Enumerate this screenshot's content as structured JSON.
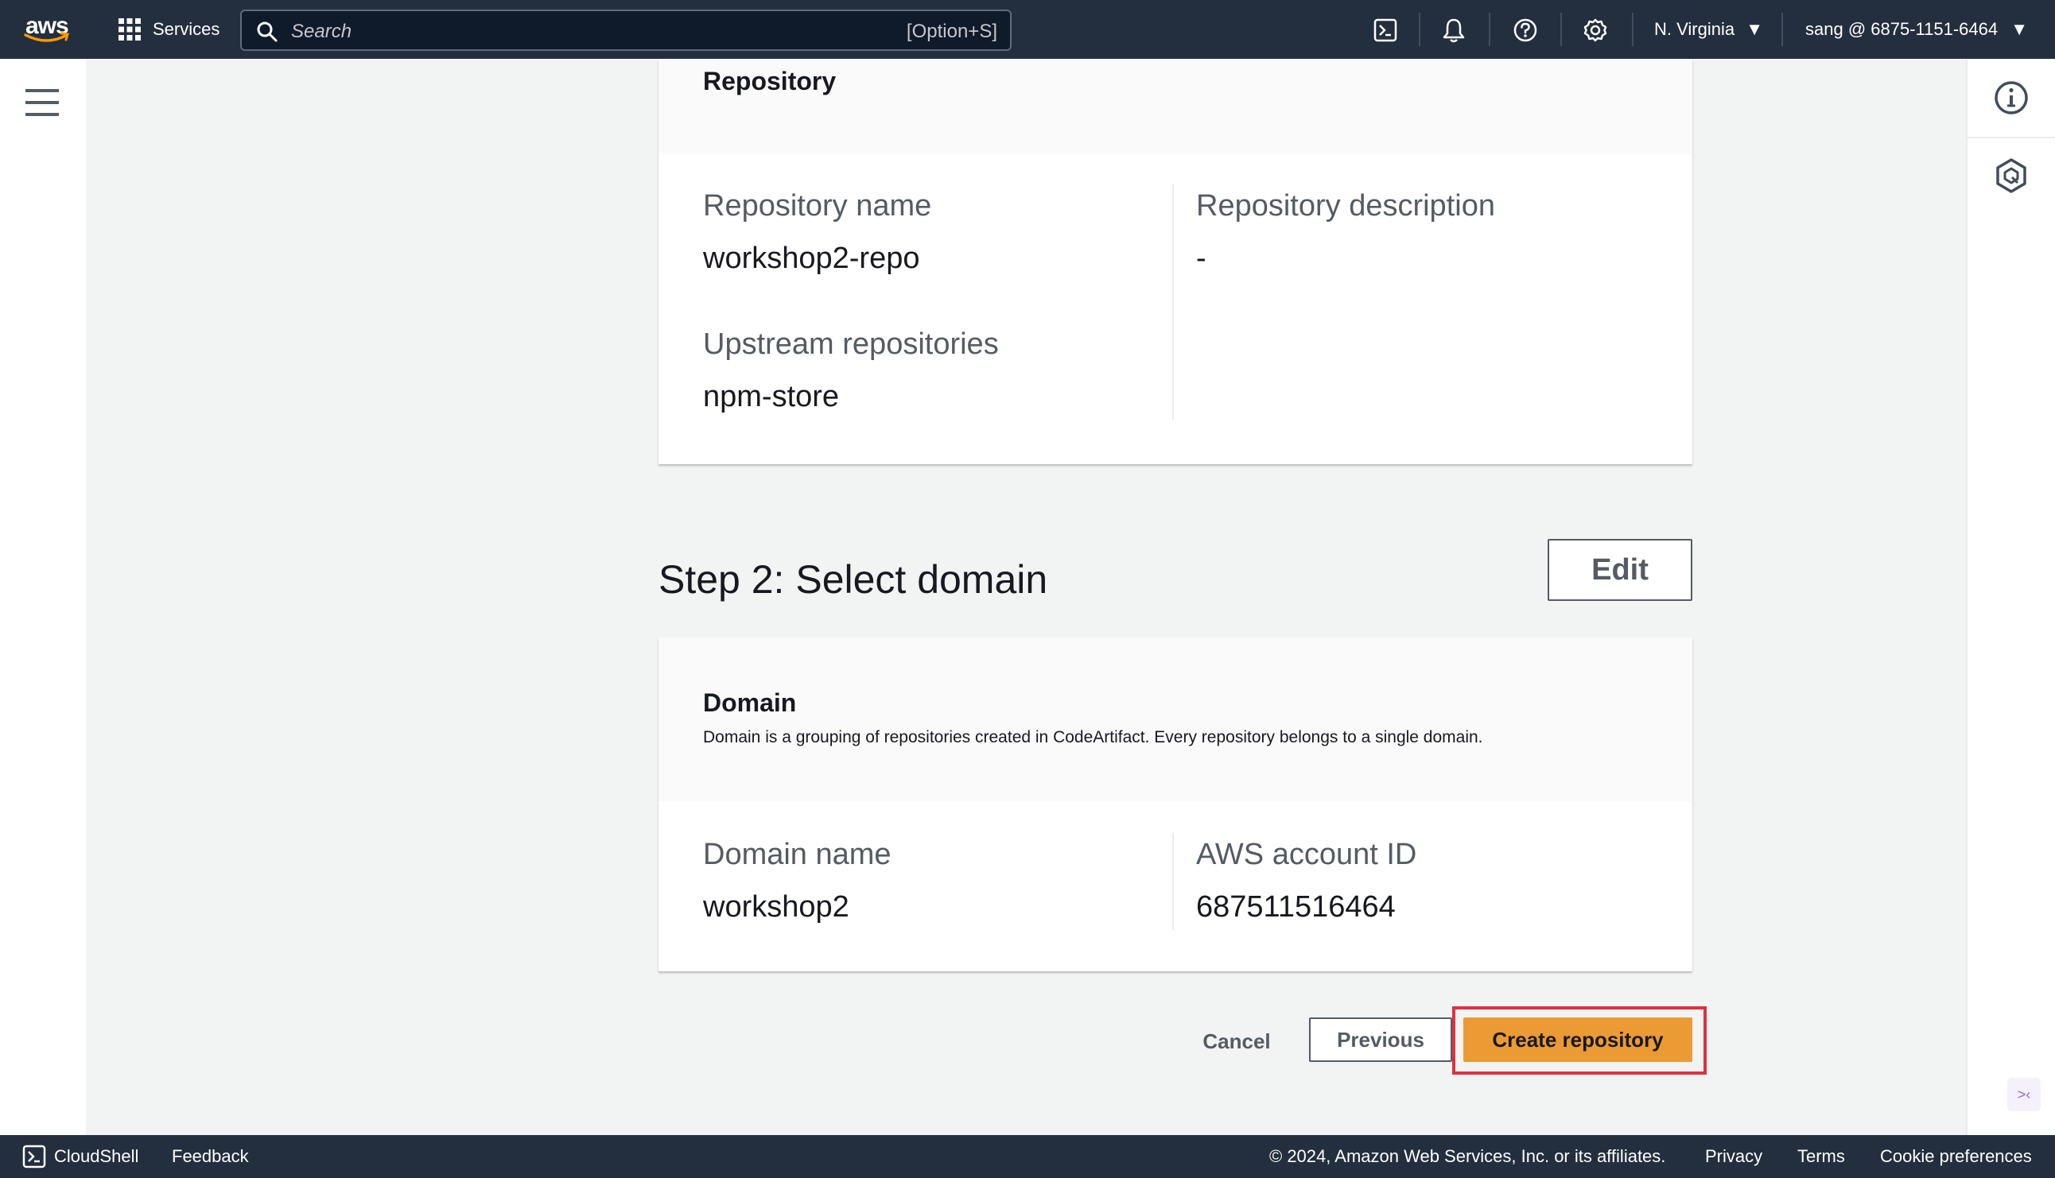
{
  "topnav": {
    "logo_text": "aws",
    "services_label": "Services",
    "search_placeholder": "Search",
    "search_shortcut": "[Option+S]",
    "icons": [
      "cloudshell-icon",
      "bell-icon",
      "help-icon",
      "settings-icon"
    ],
    "region": "N. Virginia",
    "account": "sang @ 6875-1151-6464"
  },
  "repository_card": {
    "title": "Repository",
    "repository_name_label": "Repository name",
    "repository_name": "workshop2-repo",
    "description_label": "Repository description",
    "description": "-",
    "upstream_label": "Upstream repositories",
    "upstream": "npm-store"
  },
  "step2": {
    "title": "Step 2: Select domain",
    "edit_label": "Edit"
  },
  "domain_card": {
    "title": "Domain",
    "description": "Domain is a grouping of repositories created in CodeArtifact. Every repository belongs to a single domain.",
    "domain_name_label": "Domain name",
    "domain_name": "workshop2",
    "account_id_label": "AWS account ID",
    "account_id": "687511516464"
  },
  "actions": {
    "cancel": "Cancel",
    "previous": "Previous",
    "create": "Create repository"
  },
  "footer": {
    "cloudshell": "CloudShell",
    "feedback": "Feedback",
    "copyright": "© 2024, Amazon Web Services, Inc. or its affiliates.",
    "privacy": "Privacy",
    "terms": "Terms",
    "cookies": "Cookie preferences"
  },
  "colors": {
    "nav_bg": "#232f3e",
    "primary_button": "#ec9a34",
    "highlight": "#e0313e"
  }
}
